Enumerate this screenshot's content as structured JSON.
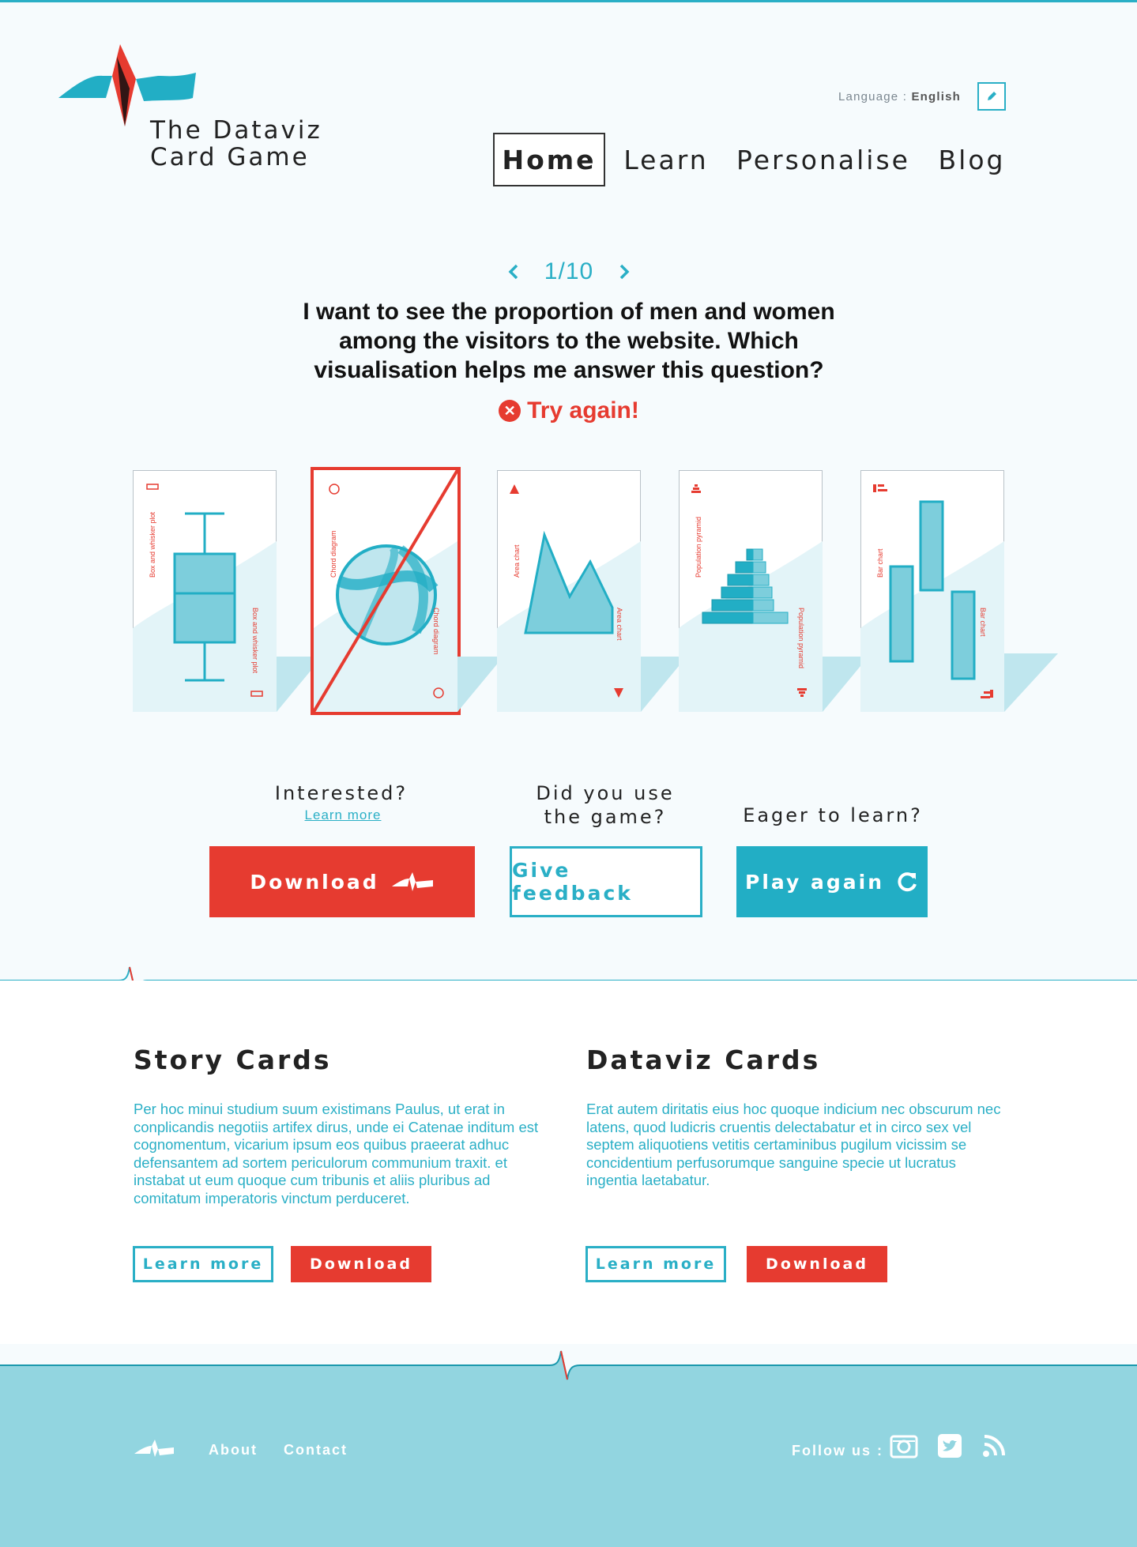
{
  "brand": {
    "title": "The Dataviz Card Game",
    "colors": {
      "red": "#e63b30",
      "teal": "#2aafc6",
      "footer": "#92d5e0",
      "background": "#f6fbfd"
    }
  },
  "header": {
    "language_label": "Language :",
    "language_value": "English",
    "language_edit_icon": "pencil-icon",
    "nav": [
      {
        "label": "Home",
        "active": true
      },
      {
        "label": "Learn",
        "active": false
      },
      {
        "label": "Personalise",
        "active": false
      },
      {
        "label": "Blog",
        "active": false
      }
    ]
  },
  "quiz": {
    "counter": "1/10",
    "prev_icon": "chevron-left-icon",
    "next_icon": "chevron-right-icon",
    "question": "I want to see the proportion of men and women among the visitors to the website. Which visualisation helps me answer this question?",
    "feedback": "Try again!",
    "feedback_icon": "error-x-icon",
    "cards": [
      {
        "name": "Box and whisker plot",
        "selected_wrong": false
      },
      {
        "name": "Chord diagram",
        "selected_wrong": true
      },
      {
        "name": "Area chart",
        "selected_wrong": false
      },
      {
        "name": "Population pyramid",
        "selected_wrong": false
      },
      {
        "name": "Bar chart",
        "selected_wrong": false
      }
    ]
  },
  "cta": {
    "interested": "Interested?",
    "learn_more": "Learn more",
    "did_you_use": "Did you use the game?",
    "eager": "Eager to learn?",
    "download": "Download",
    "feedback": "Give feedback",
    "play_again": "Play again"
  },
  "sections": {
    "story": {
      "title": "Story Cards",
      "body": "Per hoc minui studium suum existimans Paulus, ut erat in conplicandis negotiis artifex dirus, unde ei Catenae inditum est cognomentum, vicarium ipsum eos quibus praeerat adhuc defensantem ad sortem periculorum communium traxit. et instabat ut eum quoque cum tribunis et aliis pluribus ad comitatum imperatoris vinctum perduceret.",
      "learn_more": "Learn more",
      "download": "Download"
    },
    "dataviz": {
      "title": "Dataviz Cards",
      "body": "Erat autem diritatis eius hoc quoque indicium nec obscurum nec latens, quod ludicris cruentis delectabatur et in circo sex vel septem aliquotiens vetitis certaminibus pugilum vicissim se concidentium perfusorumque sanguine specie ut lucratus ingentia laetabatur.",
      "learn_more": "Learn more",
      "download": "Download"
    }
  },
  "footer": {
    "about": "About",
    "contact": "Contact",
    "follow": "Follow us :",
    "social": [
      "instagram-icon",
      "twitter-icon",
      "rss-icon"
    ]
  }
}
